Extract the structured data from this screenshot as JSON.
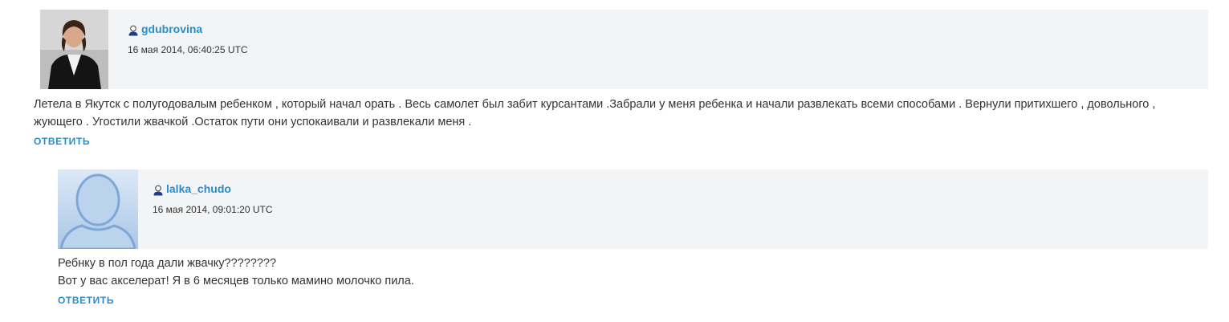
{
  "comments": [
    {
      "username": "gdubrovina",
      "timestamp": "16 мая 2014, 06:40:25 UTC",
      "text": "Летела в Якутск с полугодовалым ребенком , который начал орать . Весь самолет был забит курсантами .Забрали у меня ребенка и начали развлекать всеми способами . Вернули притихшего , довольного , жующего . Угостили жвачкой .Остаток пути они успокаивали и развлекали меня .",
      "reply_label": "ОТВЕТИТЬ"
    },
    {
      "username": "lalka_chudo",
      "timestamp": "16 мая 2014, 09:01:20 UTC",
      "text_lines": [
        "Ребнку в пол года дали жвачку????????",
        "Вот у вас акселерат! Я в 6 месяцев только мамино молочко пила."
      ],
      "reply_label": "ОТВЕТИТЬ"
    }
  ],
  "colors": {
    "link": "#2b8dc7",
    "header_bg": "#f3f4f6",
    "text": "#333333"
  },
  "icons": {
    "user": "user-icon",
    "avatar_photo": "avatar-photo",
    "avatar_placeholder": "default-avatar-icon"
  }
}
